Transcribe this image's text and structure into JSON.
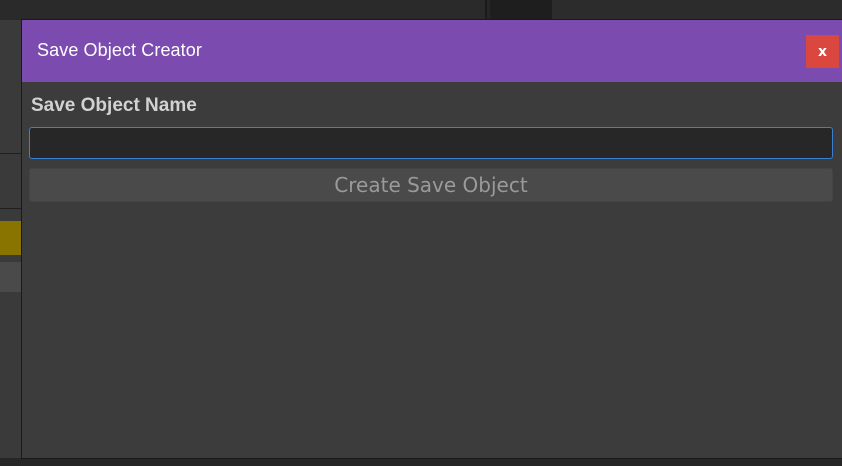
{
  "window": {
    "title": "Save Object Creator",
    "close_label": "x",
    "titlebar_color": "#7b4bb0",
    "close_color": "#d9473f"
  },
  "form": {
    "field_label": "Save Object Name",
    "name_value": "",
    "name_placeholder": "",
    "submit_label": "Create Save Object",
    "input_focus_color": "#3b7fd1"
  },
  "icons": {
    "close": "close-icon"
  }
}
